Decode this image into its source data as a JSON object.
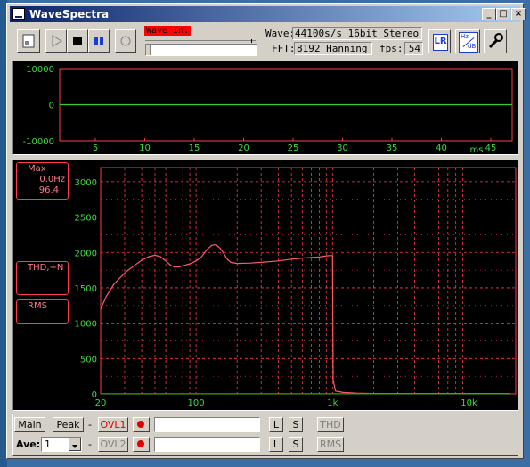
{
  "window": {
    "title": "WaveSpectra"
  },
  "titlebar_buttons": {
    "minimize": "_",
    "maximize": "□",
    "close": "×"
  },
  "toolbar": {
    "wave_in_badge": "Wave In.",
    "wave_label": "Wave:",
    "wave_value": "44100s/s 16bit Stereo",
    "fft_label": "FFT:",
    "fft_value": "8192 Hanning",
    "fps_label": "fps:",
    "fps_value": "54",
    "lr_icon": "LR",
    "hz_db_top": "Hz",
    "hz_db_bottom": "dB"
  },
  "wave_panel": {
    "y_labels": [
      "10000",
      "0",
      "-10000"
    ],
    "x_labels": [
      "5",
      "10",
      "15",
      "20",
      "25",
      "30",
      "35",
      "40",
      "45"
    ],
    "x_unit": "ms"
  },
  "spectrum_panel": {
    "max_label": "Max",
    "max_freq": "0.0Hz",
    "max_value": "96.4",
    "thd_label": "THD,+N",
    "rms_label": "RMS",
    "y_labels": [
      "3000",
      "2500",
      "2000",
      "1500",
      "1000",
      "500",
      "0"
    ],
    "x_labels": [
      "20",
      "100",
      "1k",
      "10k"
    ]
  },
  "chart_data": {
    "type": "line",
    "title": "",
    "xlabel": "",
    "ylabel": "",
    "x_scale": "log",
    "xlim": [
      20,
      22000
    ],
    "ylim": [
      0,
      3200
    ],
    "grid": true,
    "series": [
      {
        "color": "#ff5a6e",
        "x": [
          20,
          22,
          25,
          30,
          35,
          40,
          45,
          50,
          55,
          60,
          65,
          70,
          75,
          80,
          90,
          100,
          110,
          120,
          130,
          140,
          150,
          160,
          170,
          180,
          200,
          250,
          300,
          400,
          500,
          600,
          700,
          800,
          900,
          950,
          990,
          1000,
          1010,
          1050,
          1200,
          1500,
          2000,
          3000,
          5000,
          10000,
          20000
        ],
        "y": [
          1200,
          1380,
          1550,
          1710,
          1810,
          1890,
          1940,
          1960,
          1940,
          1880,
          1820,
          1790,
          1795,
          1810,
          1840,
          1880,
          1940,
          2040,
          2100,
          2110,
          2060,
          1980,
          1900,
          1860,
          1845,
          1850,
          1860,
          1880,
          1905,
          1920,
          1930,
          1935,
          1950,
          1955,
          1955,
          1950,
          200,
          40,
          20,
          10,
          5,
          5,
          5,
          5,
          5
        ]
      },
      {
        "color": "#00c000",
        "x": [
          20,
          100,
          1000,
          10000,
          20000
        ],
        "y": [
          3,
          3,
          3,
          3,
          3
        ]
      }
    ]
  },
  "bottom": {
    "main_label": "Main",
    "peak_label": "Peak",
    "dash1": "-",
    "dash2": "-",
    "ovl1_label": "OVL1",
    "ovl2_label": "OVL2",
    "ave_label": "Ave:",
    "ave_value": "1",
    "l_label": "L",
    "s_label": "S",
    "thd_button": "THD",
    "rms_button": "RMS"
  }
}
